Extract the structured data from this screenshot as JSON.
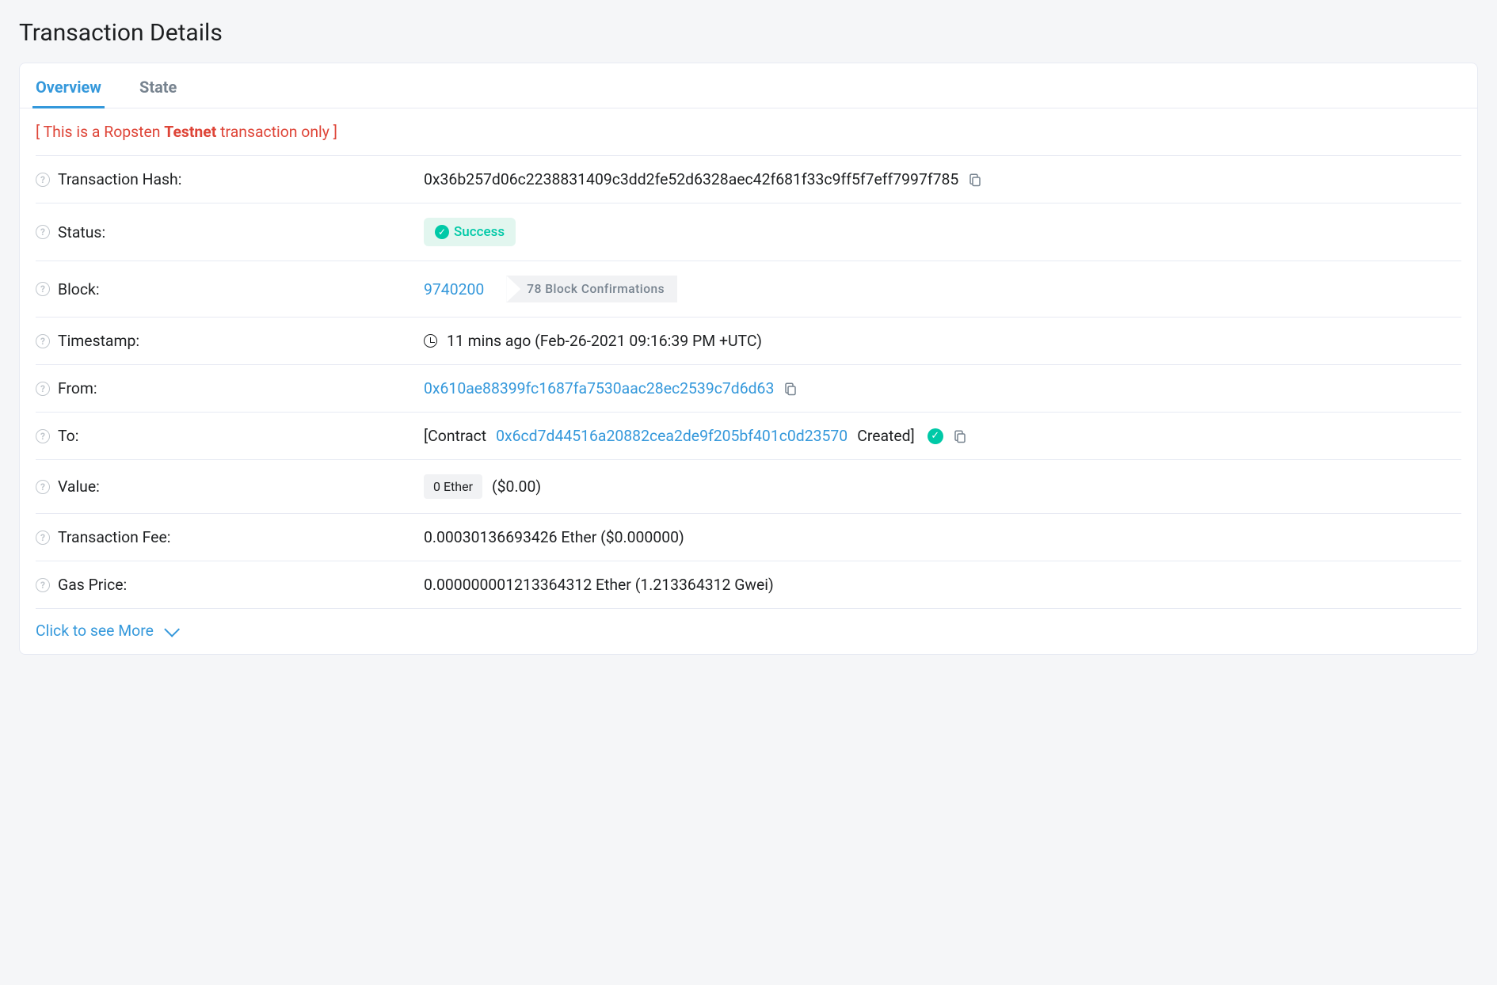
{
  "pageTitle": "Transaction Details",
  "tabs": {
    "overview": "Overview",
    "state": "State"
  },
  "notice": {
    "prefix": "[ This is a Ropsten ",
    "bold": "Testnet",
    "suffix": " transaction only ]"
  },
  "labels": {
    "hash": "Transaction Hash:",
    "status": "Status:",
    "block": "Block:",
    "timestamp": "Timestamp:",
    "from": "From:",
    "to": "To:",
    "value": "Value:",
    "fee": "Transaction Fee:",
    "gasPrice": "Gas Price:"
  },
  "values": {
    "hash": "0x36b257d06c2238831409c3dd2fe52d6328aec42f681f33c9ff5f7eff7997f785",
    "statusText": "Success",
    "blockNumber": "9740200",
    "confirmations": "78 Block Confirmations",
    "timestamp": "11 mins ago (Feb-26-2021 09:16:39 PM +UTC)",
    "fromAddress": "0x610ae88399fc1687fa7530aac28ec2539c7d6d63",
    "toPrefix": "[Contract ",
    "toAddress": "0x6cd7d44516a20882cea2de9f205bf401c0d23570",
    "toSuffix": " Created]",
    "valueEther": "0 Ether",
    "valueUsd": "($0.00)",
    "fee": "0.00030136693426 Ether ($0.000000)",
    "gasPrice": "0.000000001213364312 Ether (1.213364312 Gwei)"
  },
  "seeMore": "Click to see More"
}
